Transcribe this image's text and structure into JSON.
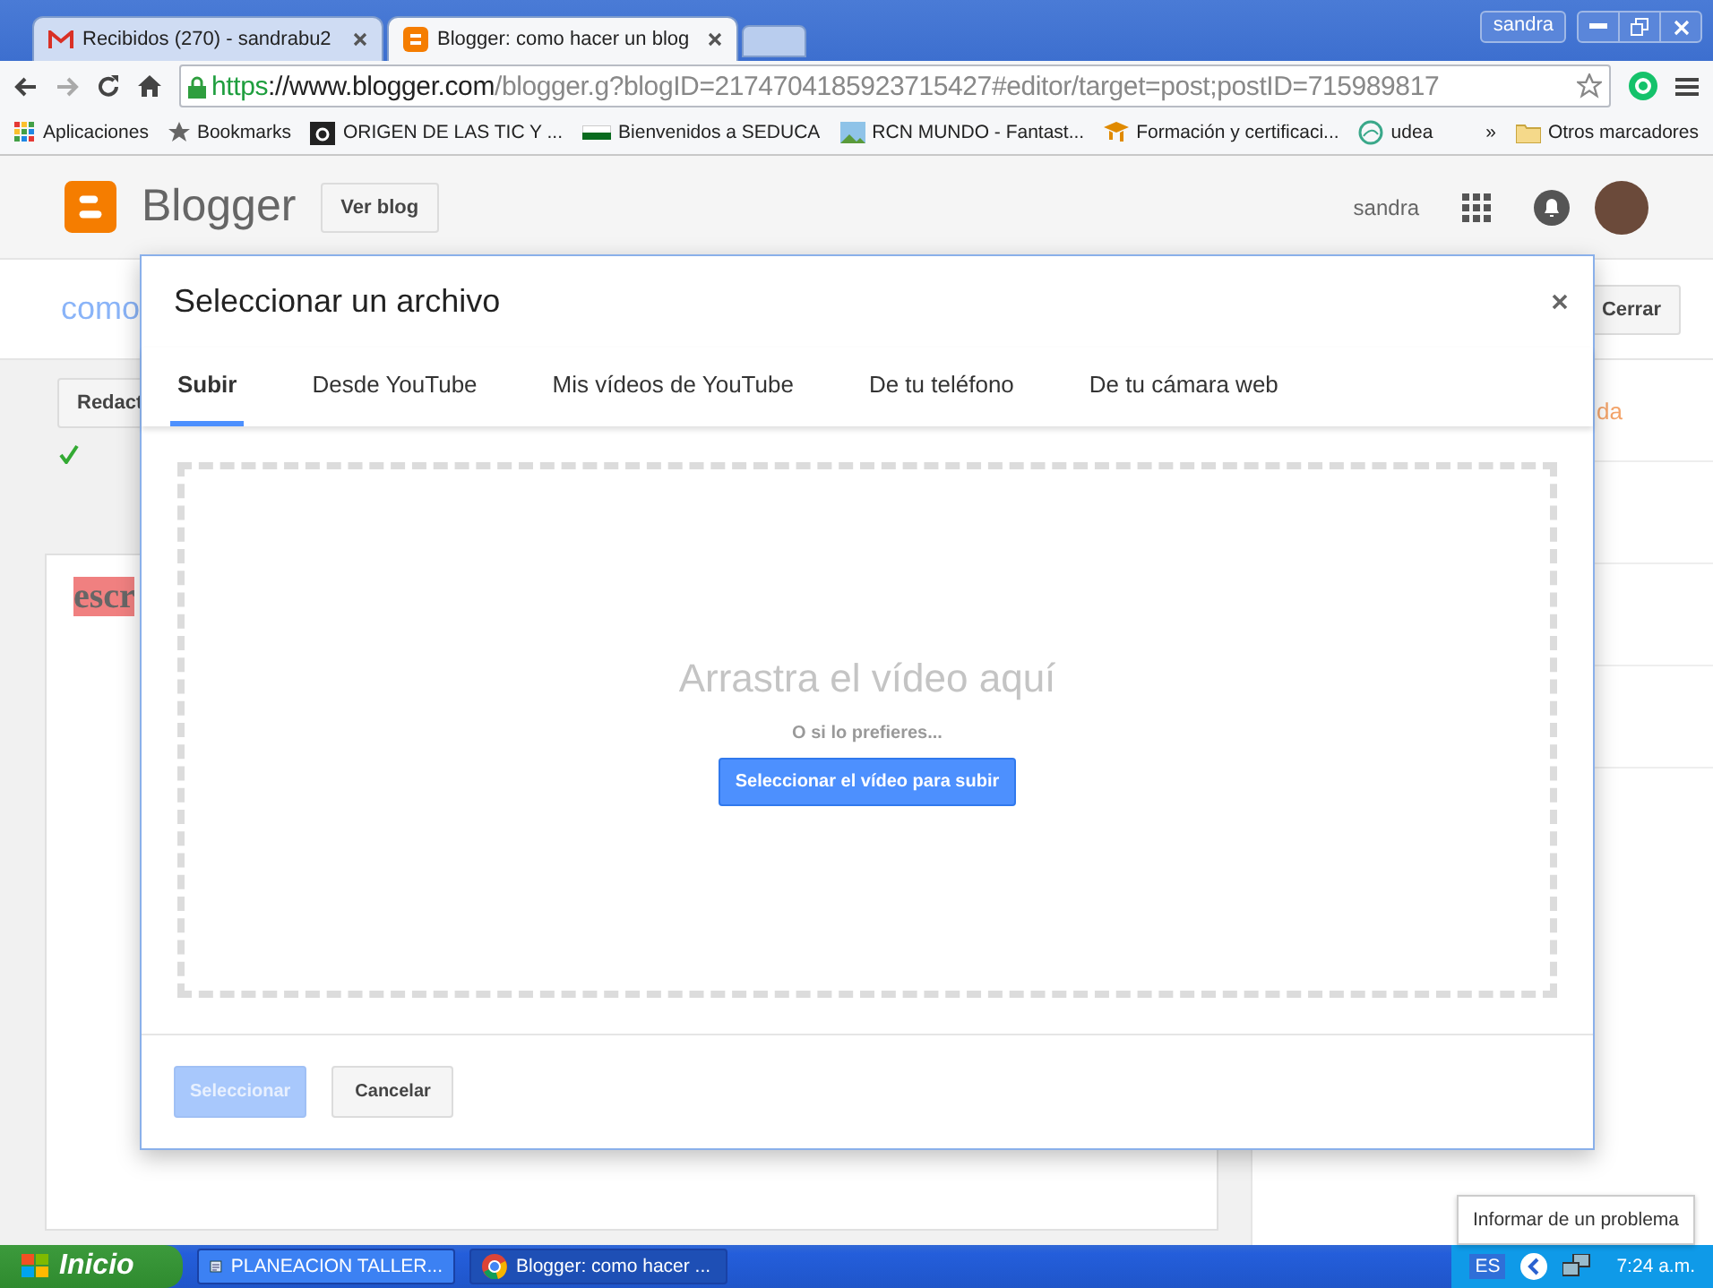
{
  "browser": {
    "tabs": [
      {
        "title": "Recibidos (270) - sandrabu2",
        "kind": "mail",
        "selected": false
      },
      {
        "title": "Blogger: como hacer un blog",
        "kind": "blogger",
        "selected": true
      }
    ],
    "user": "sandra",
    "url": {
      "scheme": "https",
      "host": "://www.blogger.com",
      "path": "/blogger.g?blogID=2174704185923715427#editor/target=post;postID=715989817"
    },
    "bookmarks": [
      {
        "label": "Aplicaciones",
        "kind": "apps"
      },
      {
        "label": "Bookmarks",
        "kind": "star"
      },
      {
        "label": "ORIGEN DE LAS TIC Y ...",
        "kind": "site"
      },
      {
        "label": "Bienvenidos a SEDUCA",
        "kind": "flag"
      },
      {
        "label": "RCN MUNDO - Fantast...",
        "kind": "image"
      },
      {
        "label": "Formación y certificaci...",
        "kind": "cap"
      },
      {
        "label": "udea",
        "kind": "globe"
      }
    ],
    "more": "»",
    "other_bookmarks": "Otros marcadores"
  },
  "blogger": {
    "logo": "Blogger",
    "view_blog": "Ver blog",
    "user": "sandra"
  },
  "editor": {
    "post_title": "como",
    "close": "Cerrar",
    "compose": "Redact",
    "text": "escr",
    "sidebar_link": "da"
  },
  "dialog": {
    "title": "Seleccionar un archivo",
    "tabs": [
      {
        "label": "Subir",
        "selected": true
      },
      {
        "label": "Desde YouTube",
        "selected": false
      },
      {
        "label": "Mis vídeos de YouTube",
        "selected": false
      },
      {
        "label": "De tu teléfono",
        "selected": false
      },
      {
        "label": "De tu cámara web",
        "selected": false
      }
    ],
    "drop_text": "Arrastra el vídeo aquí",
    "or_text": "O si lo prefieres...",
    "upload_button": "Seleccionar el vídeo para subir",
    "select_button": {
      "label": "Seleccionar",
      "disabled": true
    },
    "cancel_button": "Cancelar"
  },
  "tooltip": "Informar de un problema",
  "taskbar": {
    "start": "Inicio",
    "tasks": [
      {
        "label": "PLANEACION TALLER...",
        "kind": "doc",
        "selected": false
      },
      {
        "label": "Blogger: como hacer ...",
        "kind": "chrome",
        "selected": true
      }
    ],
    "language": "ES",
    "clock": "7:24 a.m."
  }
}
